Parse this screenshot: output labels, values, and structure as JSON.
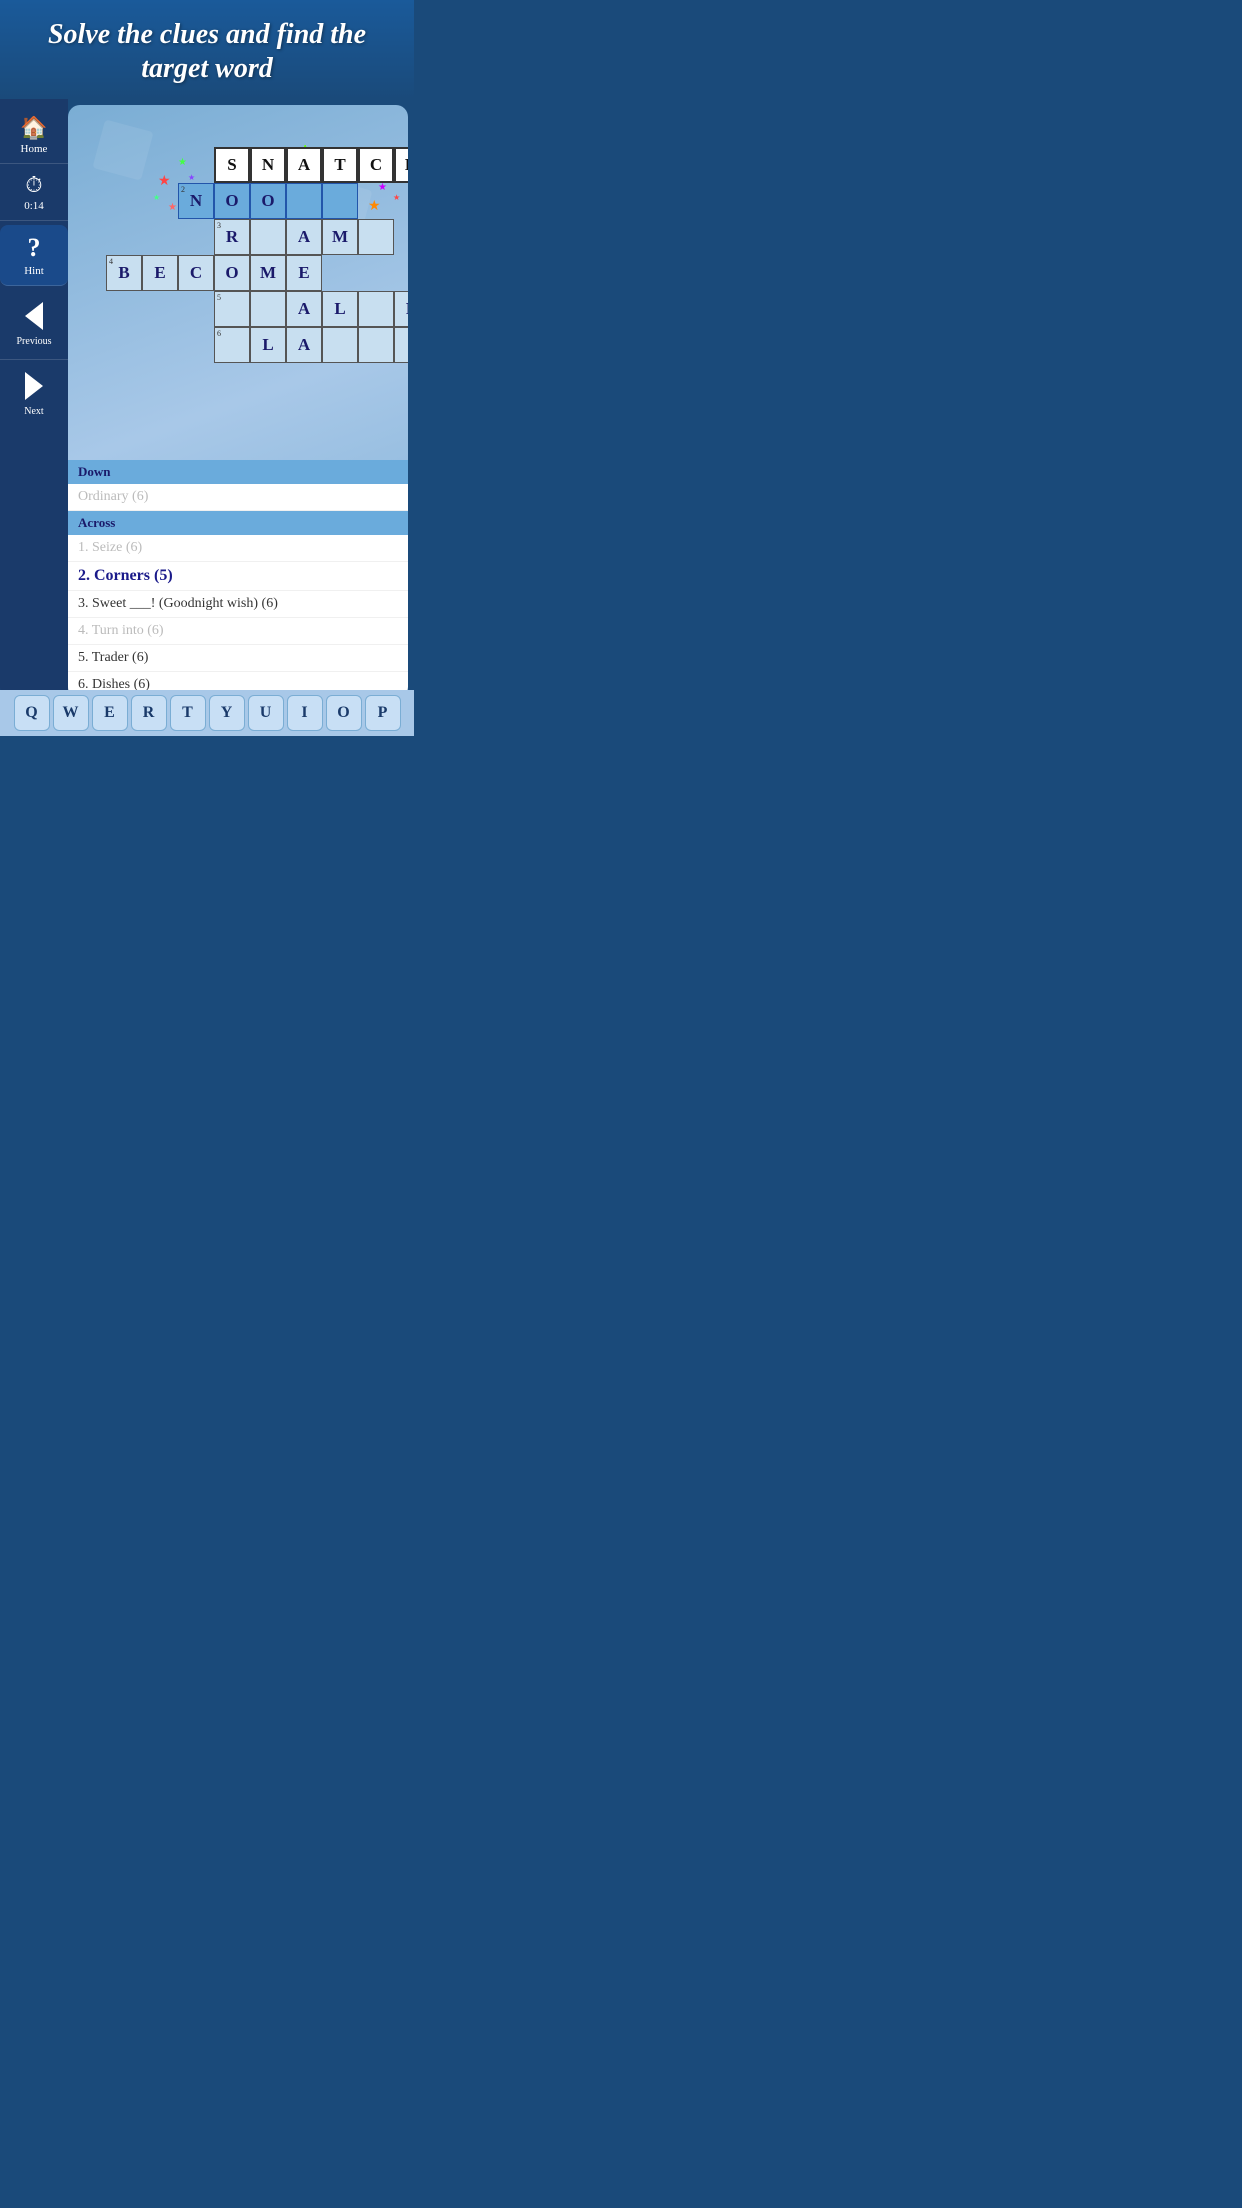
{
  "header": {
    "title": "Solve the clues and find the target word"
  },
  "sidebar": {
    "home_label": "Home",
    "timer_label": "0:14",
    "hint_label": "Hint",
    "previous_label": "Previous",
    "next_label": "Next"
  },
  "crossword": {
    "rows": [
      {
        "row_num": 1,
        "cells": [
          {
            "type": "empty"
          },
          {
            "type": "empty"
          },
          {
            "type": "empty"
          },
          {
            "letter": "S",
            "style": "solved"
          },
          {
            "letter": "N",
            "style": "solved"
          },
          {
            "letter": "A",
            "style": "solved"
          },
          {
            "letter": "T",
            "style": "solved"
          },
          {
            "letter": "C",
            "style": "solved"
          },
          {
            "letter": "H",
            "style": "solved"
          }
        ]
      },
      {
        "row_num": 2,
        "cells": [
          {
            "type": "empty"
          },
          {
            "type": "empty"
          },
          {
            "letter": "N",
            "style": "active",
            "clue_num": "2"
          },
          {
            "letter": "O",
            "style": "active"
          },
          {
            "letter": "O",
            "style": "active"
          },
          {
            "letter": "",
            "style": "active"
          },
          {
            "letter": "",
            "style": "active"
          },
          {
            "type": "end"
          }
        ]
      },
      {
        "row_num": 3,
        "cells": [
          {
            "type": "empty"
          },
          {
            "type": "empty"
          },
          {
            "type": "empty"
          },
          {
            "letter": "R",
            "style": "light",
            "clue_num": "3"
          },
          {
            "letter": "",
            "style": "light"
          },
          {
            "letter": "A",
            "style": "light"
          },
          {
            "letter": "M",
            "style": "light"
          },
          {
            "letter": "",
            "style": "light"
          }
        ]
      },
      {
        "row_num": 4,
        "cells": [
          {
            "letter": "B",
            "style": "light",
            "clue_num": "4"
          },
          {
            "letter": "E",
            "style": "light"
          },
          {
            "letter": "C",
            "style": "light"
          },
          {
            "letter": "O",
            "style": "light"
          },
          {
            "letter": "M",
            "style": "light"
          },
          {
            "letter": "E",
            "style": "light"
          }
        ]
      },
      {
        "row_num": 5,
        "cells": [
          {
            "type": "empty"
          },
          {
            "type": "empty"
          },
          {
            "type": "empty"
          },
          {
            "letter": "",
            "style": "light",
            "clue_num": "5"
          },
          {
            "letter": "",
            "style": "light"
          },
          {
            "letter": "A",
            "style": "light"
          },
          {
            "letter": "L",
            "style": "light"
          },
          {
            "letter": "",
            "style": "light"
          },
          {
            "letter": "R",
            "style": "light"
          }
        ]
      },
      {
        "row_num": 6,
        "cells": [
          {
            "type": "empty"
          },
          {
            "type": "empty"
          },
          {
            "type": "empty"
          },
          {
            "letter": "",
            "style": "light",
            "clue_num": "6"
          },
          {
            "letter": "L",
            "style": "light"
          },
          {
            "letter": "A",
            "style": "light"
          },
          {
            "letter": "",
            "style": "light"
          },
          {
            "letter": "",
            "style": "light"
          },
          {
            "letter": "",
            "style": "light"
          }
        ]
      }
    ]
  },
  "clues": {
    "down_header": "Down",
    "down_clues": [
      {
        "text": "Ordinary (6)",
        "style": "faded"
      }
    ],
    "across_header": "Across",
    "across_clues": [
      {
        "num": "1.",
        "text": "Seize (6)",
        "style": "faded"
      },
      {
        "num": "2.",
        "text": "Corners (5)",
        "style": "active"
      },
      {
        "num": "3.",
        "text": "Sweet ___! (Goodnight wish) (6)",
        "style": "normal"
      },
      {
        "num": "4.",
        "text": "Turn into (6)",
        "style": "faded"
      },
      {
        "num": "5.",
        "text": "Trader (6)",
        "style": "normal"
      },
      {
        "num": "6.",
        "text": "Dishes (6)",
        "style": "normal"
      }
    ]
  },
  "keyboard": {
    "keys": [
      "Q",
      "W",
      "E",
      "R",
      "T",
      "Y",
      "U",
      "I",
      "O",
      "P"
    ]
  }
}
